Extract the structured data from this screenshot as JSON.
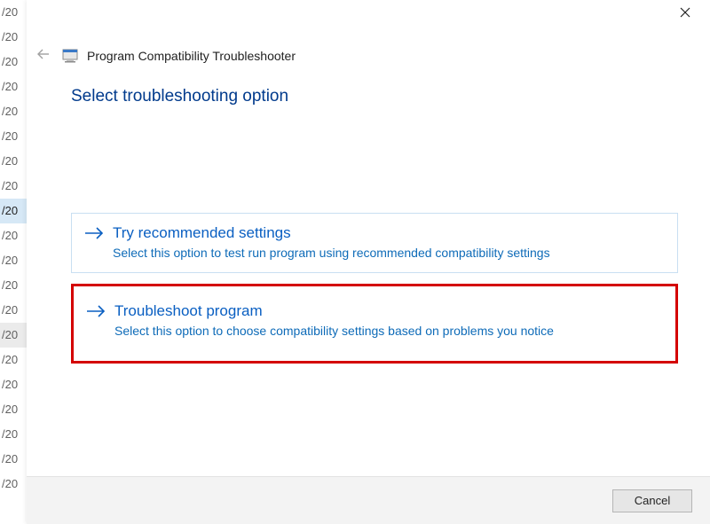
{
  "background_list": {
    "item_text": "/20",
    "selected_index": 8,
    "hover_index": 13,
    "count": 20
  },
  "dialog": {
    "wizard_title": "Program Compatibility Troubleshooter",
    "heading": "Select troubleshooting option",
    "options": [
      {
        "title": "Try recommended settings",
        "desc": "Select this option to test run program using recommended compatibility settings"
      },
      {
        "title": "Troubleshoot program",
        "desc": "Select this option to choose compatibility settings based on problems you notice"
      }
    ],
    "cancel_label": "Cancel"
  }
}
